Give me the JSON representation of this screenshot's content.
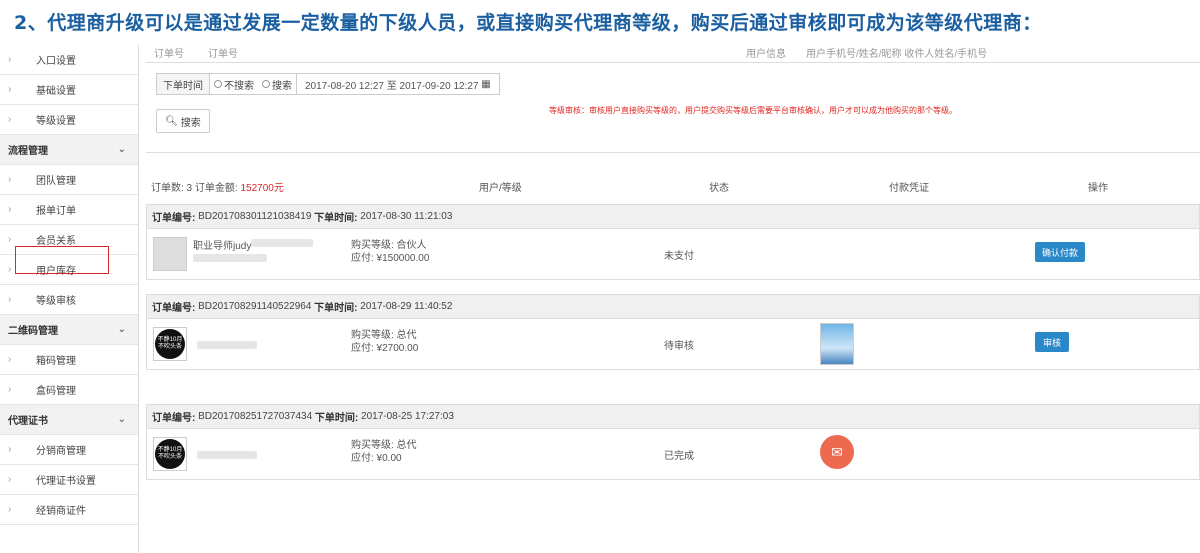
{
  "heading": "2、代理商升级可以是通过发展一定数量的下级人员，或直接购买代理商等级，购买后通过审核即可成为该等级代理商：",
  "sidebar": [
    {
      "type": "item",
      "label": "入口设置"
    },
    {
      "type": "item",
      "label": "基础设置"
    },
    {
      "type": "item",
      "label": "等级设置"
    },
    {
      "type": "group",
      "label": "流程管理"
    },
    {
      "type": "item",
      "label": "团队管理"
    },
    {
      "type": "item",
      "label": "报单订单"
    },
    {
      "type": "item",
      "label": "会员关系"
    },
    {
      "type": "item",
      "label": "用户库存"
    },
    {
      "type": "item",
      "label": "等级审核",
      "active": true
    },
    {
      "type": "group",
      "label": "二维码管理"
    },
    {
      "type": "item",
      "label": "箱码管理"
    },
    {
      "type": "item",
      "label": "盒码管理"
    },
    {
      "type": "group",
      "label": "代理证书"
    },
    {
      "type": "item",
      "label": "分销商管理"
    },
    {
      "type": "item",
      "label": "代理证书设置"
    },
    {
      "type": "item",
      "label": "经销商证件"
    }
  ],
  "filter": {
    "order_no_label": "订单号",
    "order_no_placeholder": "订单号",
    "user_info_label": "用户信息",
    "user_info_placeholder": "用户手机号/姓名/昵称 收件人姓名/手机号",
    "time_label": "下单时间",
    "radio_no": "不搜索",
    "radio_yes": "搜索",
    "date_range": "2017-08-20 12:27 至 2017-09-20 12:27",
    "search_button": "搜索",
    "note": "等级审核：审核用户直接购买等级的，用户提交购买等级后需要平台审核确认，用户才可以成为他购买的那个等级。"
  },
  "summary": {
    "count_prefix": "订单数: 3 订单金额: ",
    "amount": "152700元",
    "col_user": "用户/等级",
    "col_status": "状态",
    "col_proof": "付款凭证",
    "col_action": "操作"
  },
  "orders": [
    {
      "order_label": "订单编号:",
      "order_no": "BD201708301121038419",
      "time_label": "下单时间:",
      "time": "2017-08-30 11:21:03",
      "user": "职业导师judy",
      "level": "购买等级: 合伙人",
      "pay": "应付: ¥150000.00",
      "status": "未支付",
      "action": "确认付款",
      "avatar": "photo",
      "proof": "none"
    },
    {
      "order_label": "订单编号:",
      "order_no": "BD201708291140522964",
      "time_label": "下单时间:",
      "time": "2017-08-29 11:40:52",
      "user": "",
      "level": "购买等级: 总代",
      "pay": "应付: ¥2700.00",
      "status": "待审核",
      "action": "审核",
      "avatar": "logo",
      "proof": "image"
    },
    {
      "order_label": "订单编号:",
      "order_no": "BD201708251727037434",
      "time_label": "下单时间:",
      "time": "2017-08-25 17:27:03",
      "user": "",
      "level": "购买等级: 总代",
      "pay": "应付: ¥0.00",
      "status": "已完成",
      "action": "",
      "avatar": "logo",
      "proof": "icon"
    }
  ],
  "logo_text": [
    "不静10月",
    "不吹头条"
  ],
  "colors": {
    "heading": "#1b5fa0",
    "accent": "#2b88c8",
    "amount": "#d9262b",
    "note": "#e0251f"
  }
}
